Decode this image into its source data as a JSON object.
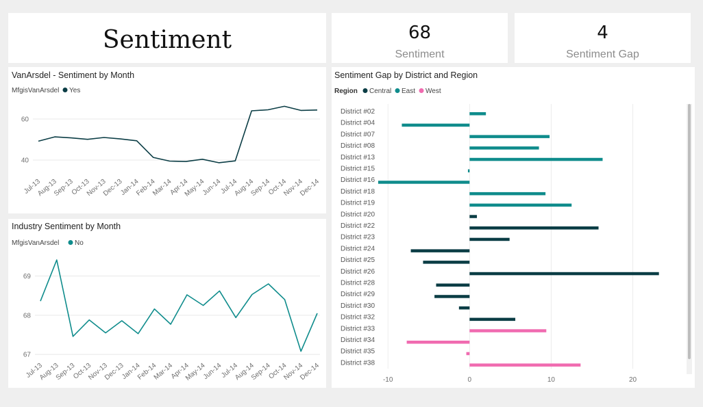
{
  "header": {
    "title": "Sentiment"
  },
  "kpis": [
    {
      "value": "68",
      "label": "Sentiment"
    },
    {
      "value": "4",
      "label": "Sentiment Gap"
    }
  ],
  "colors": {
    "central": "#0b3d45",
    "east": "#0f8c8c",
    "west": "#f06bb0"
  },
  "chart_data": [
    {
      "type": "line",
      "title": "VanArsdel - Sentiment by Month",
      "legend": {
        "title": "MfgisVanArsdel",
        "items": [
          {
            "label": "Yes",
            "color": "#0b3d45"
          }
        ],
        "placement": "top-left"
      },
      "categories": [
        "Jul-13",
        "Aug-13",
        "Sep-13",
        "Oct-13",
        "Nov-13",
        "Dec-13",
        "Jan-14",
        "Feb-14",
        "Mar-14",
        "Apr-14",
        "May-14",
        "Jun-14",
        "Jul-14",
        "Aug-14",
        "Sep-14",
        "Oct-14",
        "Nov-14",
        "Dec-14"
      ],
      "series": [
        {
          "name": "Yes",
          "color": "#0b3d45",
          "values": [
            49.2,
            51.3,
            50.8,
            50.1,
            51.0,
            50.3,
            49.4,
            41.3,
            39.5,
            39.3,
            40.4,
            38.7,
            39.6,
            64.0,
            64.5,
            66.2,
            64.2,
            64.4
          ]
        }
      ],
      "yticks": [
        40,
        60
      ],
      "ylim": [
        34,
        72
      ],
      "grid": true
    },
    {
      "type": "line",
      "title": "Industry Sentiment by Month",
      "legend": {
        "title": "MfgisVanArsdel",
        "items": [
          {
            "label": "No",
            "color": "#0f8c8c"
          }
        ],
        "placement": "top-left"
      },
      "categories": [
        "Jul-13",
        "Aug-13",
        "Sep-13",
        "Oct-13",
        "Nov-13",
        "Dec-13",
        "Jan-14",
        "Feb-14",
        "Mar-14",
        "Apr-14",
        "May-14",
        "Jun-14",
        "Jul-14",
        "Aug-14",
        "Sep-14",
        "Oct-14",
        "Nov-14",
        "Dec-14"
      ],
      "series": [
        {
          "name": "No",
          "color": "#0f8c8c",
          "values": [
            68.36,
            69.41,
            67.46,
            67.88,
            67.55,
            67.86,
            67.53,
            68.16,
            67.77,
            68.52,
            68.25,
            68.62,
            67.94,
            68.53,
            68.8,
            68.4,
            67.08,
            68.05
          ]
        }
      ],
      "yticks": [
        67,
        68,
        69
      ],
      "ylim": [
        66.95,
        69.55
      ],
      "grid": true
    },
    {
      "type": "bar",
      "orientation": "horizontal",
      "title": "Sentiment Gap by District and Region",
      "legend": {
        "title": "Region",
        "items": [
          {
            "label": "Central",
            "color": "#0b3d45"
          },
          {
            "label": "East",
            "color": "#0f8c8c"
          },
          {
            "label": "West",
            "color": "#f06bb0"
          }
        ],
        "placement": "top-left"
      },
      "categories": [
        "District #02",
        "District #04",
        "District #07",
        "District #08",
        "District #13",
        "District #15",
        "District #16",
        "District #18",
        "District #19",
        "District #20",
        "District #22",
        "District #23",
        "District #24",
        "District #25",
        "District #26",
        "District #28",
        "District #29",
        "District #30",
        "District #32",
        "District #33",
        "District #34",
        "District #35",
        "District #38"
      ],
      "regions": [
        "East",
        "East",
        "East",
        "East",
        "East",
        "East",
        "East",
        "East",
        "East",
        "Central",
        "Central",
        "Central",
        "Central",
        "Central",
        "Central",
        "Central",
        "Central",
        "Central",
        "Central",
        "West",
        "West",
        "West",
        "West"
      ],
      "values": [
        2.0,
        -8.3,
        9.8,
        8.5,
        16.3,
        -0.2,
        -11.2,
        9.3,
        12.5,
        0.9,
        15.8,
        4.9,
        -7.2,
        -5.7,
        23.2,
        -4.1,
        -4.3,
        -1.3,
        5.6,
        9.4,
        -7.7,
        -0.4,
        13.6
      ],
      "xticks": [
        -10,
        0,
        10,
        20
      ],
      "xlim": [
        -12.2,
        26.5
      ],
      "grid": true
    }
  ]
}
